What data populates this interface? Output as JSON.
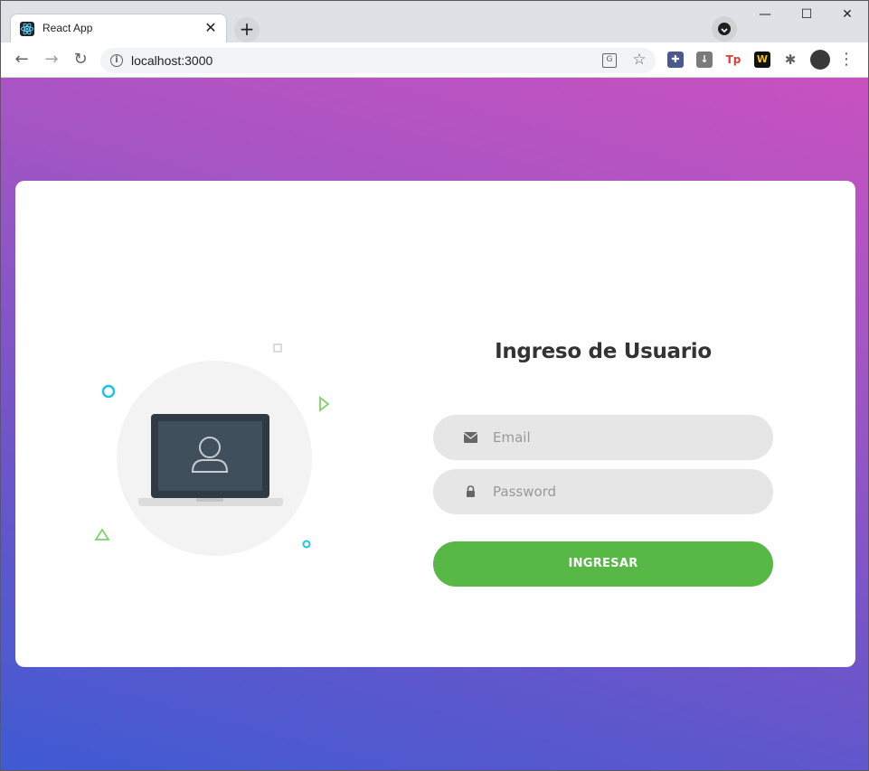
{
  "browser": {
    "tab_title": "React App",
    "tab_close_glyph": "✕",
    "new_tab_glyph": "+",
    "url": "localhost:3000",
    "info_glyph": "i",
    "translate_glyph": "G",
    "star_glyph": "☆",
    "back_glyph": "←",
    "forward_glyph": "→",
    "reload_glyph": "↻",
    "minimize_glyph": "—",
    "maximize_glyph": "☐",
    "close_glyph": "✕",
    "menu_glyph": "⋮",
    "extension_glyphs": {
      "ext1": "✚",
      "ext2": "↓",
      "ext3": "Tp",
      "ext4": "W",
      "puzzle": "✱"
    }
  },
  "login": {
    "title": "Ingreso de Usuario",
    "email_placeholder": "Email",
    "password_placeholder": "Password",
    "submit_label": "INGRESAR"
  },
  "colors": {
    "gradient_start": "#3f5bd3",
    "gradient_end": "#c951c0",
    "button_green": "#57b846",
    "field_bg": "#e6e6e6",
    "title_text": "#333333"
  },
  "icons": {
    "favicon": "react-logo-icon",
    "email": "envelope-icon",
    "password": "lock-icon",
    "illustration": "laptop-user-illustration"
  }
}
